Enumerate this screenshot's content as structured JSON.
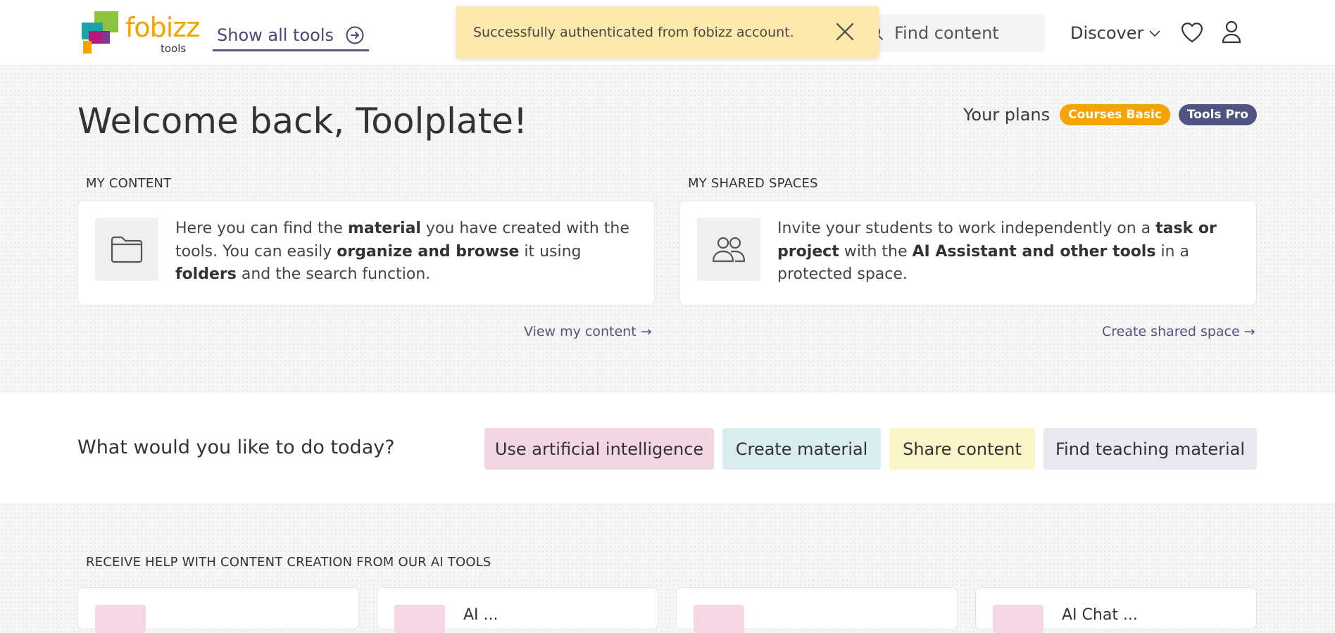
{
  "header": {
    "logo": {
      "brand": "fobizz",
      "sub": "tools"
    },
    "show_all_tools": "Show all tools",
    "search": {
      "placeholder": "Find content",
      "value": ""
    },
    "discover": "Discover"
  },
  "toast": {
    "message": "Successfully authenticated from fobizz account."
  },
  "welcome": {
    "title": "Welcome back, Toolplate!"
  },
  "plans": {
    "label": "Your plans",
    "items": [
      "Courses Basic",
      "Tools Pro"
    ]
  },
  "my_content": {
    "heading": "MY CONTENT",
    "text_parts": [
      "Here you can find the ",
      "material",
      " you have created with the tools. You can easily ",
      "organize and browse",
      " it using ",
      "folders",
      " and the search function."
    ],
    "link": "View my content →"
  },
  "shared_spaces": {
    "heading": "MY SHARED SPACES",
    "text_parts": [
      "Invite your students to work independently on a ",
      "task or project",
      " with the ",
      "AI Assistant and other tools",
      " in a protected space."
    ],
    "link": "Create shared space →"
  },
  "actions": {
    "question": "What would you like to do today?",
    "buttons": [
      {
        "label": "Use artificial intelligence",
        "color": "#f3d6e3"
      },
      {
        "label": "Create material",
        "color": "#d9ecef"
      },
      {
        "label": "Share content",
        "color": "#fbf4c6"
      },
      {
        "label": "Find teaching material",
        "color": "#e7e8f2"
      }
    ]
  },
  "ai_tools": {
    "heading": "RECEIVE HELP WITH CONTENT CREATION FROM OUR AI TOOLS",
    "cards": [
      {
        "title": ""
      },
      {
        "title": "AI ..."
      },
      {
        "title": ""
      },
      {
        "title": "AI Chat ..."
      }
    ]
  },
  "colors": {
    "accent": "#f5a300",
    "primary": "#4f5582",
    "toast_bg": "#fde9ab"
  },
  "icons": [
    "search-icon",
    "arrow-circle-right-icon",
    "chevron-down-icon",
    "heart-icon",
    "user-icon",
    "close-icon",
    "folder-icon",
    "users-icon",
    "arrow-right-icon"
  ]
}
